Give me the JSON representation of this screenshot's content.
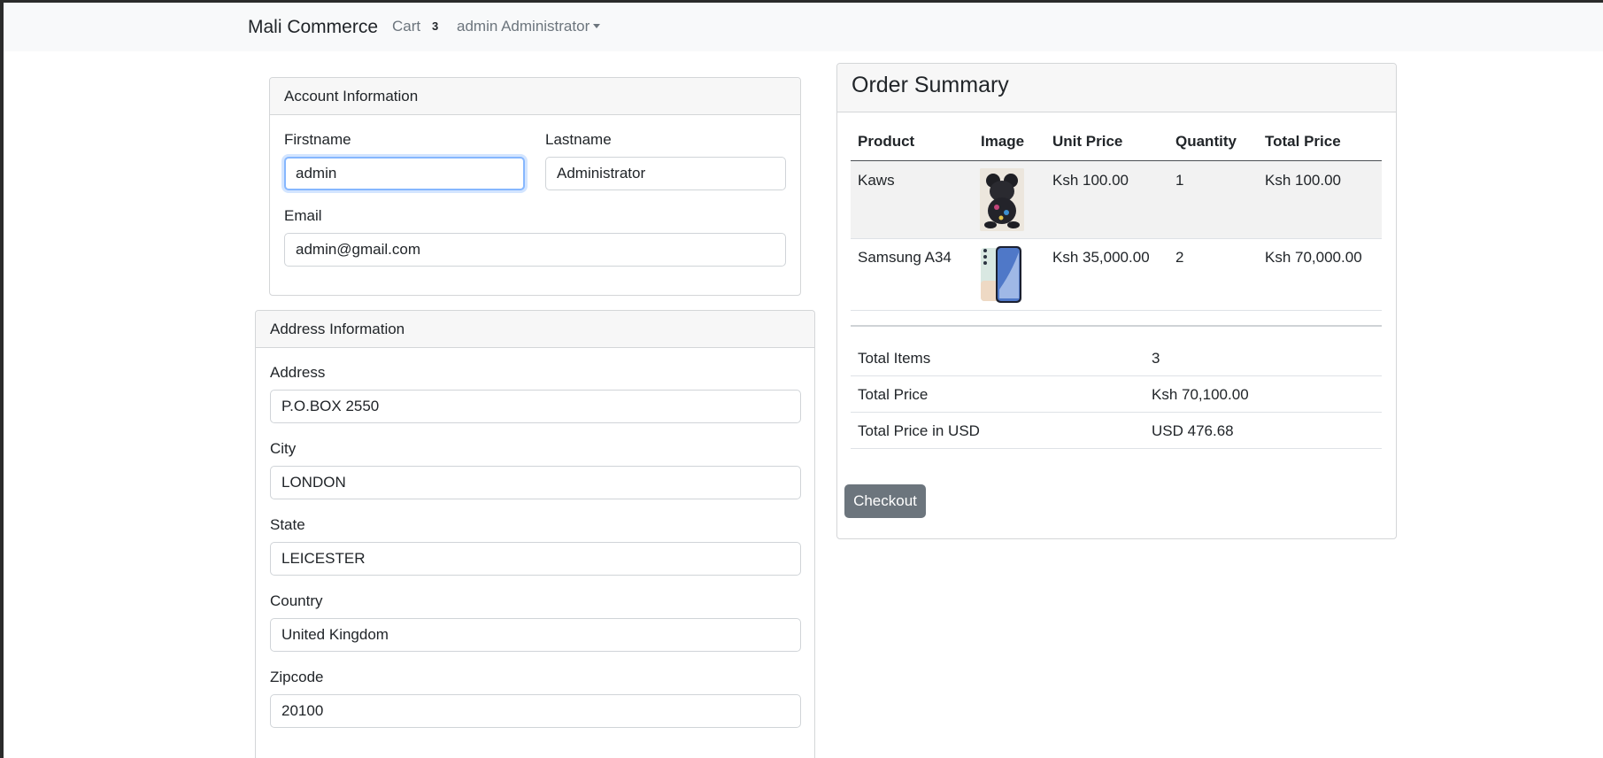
{
  "navbar": {
    "brand": "Mali Commerce",
    "cart_label": "Cart",
    "cart_count": "3",
    "user_menu": "admin Administrator"
  },
  "account": {
    "title": "Account Information",
    "firstname_label": "Firstname",
    "firstname_value": "admin",
    "lastname_label": "Lastname",
    "lastname_value": "Administrator",
    "email_label": "Email",
    "email_value": "admin@gmail.com"
  },
  "address": {
    "title": "Address Information",
    "address_label": "Address",
    "address_value": "P.O.BOX 2550",
    "city_label": "City",
    "city_value": "LONDON",
    "state_label": "State",
    "state_value": "LEICESTER",
    "country_label": "Country",
    "country_value": "United Kingdom",
    "zipcode_label": "Zipcode",
    "zipcode_value": "20100"
  },
  "order": {
    "title": "Order Summary",
    "columns": [
      "Product",
      "Image",
      "Unit Price",
      "Quantity",
      "Total Price"
    ],
    "items": [
      {
        "product": "Kaws",
        "image_icon": "kaws-figure-image",
        "unit_price": "Ksh 100.00",
        "quantity": "1",
        "total_price": "Ksh 100.00"
      },
      {
        "product": "Samsung A34",
        "image_icon": "samsung-phone-image",
        "unit_price": "Ksh 35,000.00",
        "quantity": "2",
        "total_price": "Ksh 70,000.00"
      }
    ],
    "totals": [
      {
        "label": "Total Items",
        "value": "3"
      },
      {
        "label": "Total Price",
        "value": "Ksh 70,100.00"
      },
      {
        "label": "Total Price in USD",
        "value": "USD 476.68"
      }
    ],
    "checkout_label": "Checkout"
  },
  "colors": {
    "navbar_bg": "#f8f9fa",
    "checkout_bg": "#6c757d",
    "focus_ring": "#86b7fe",
    "striped_row": "#f2f2f2"
  }
}
